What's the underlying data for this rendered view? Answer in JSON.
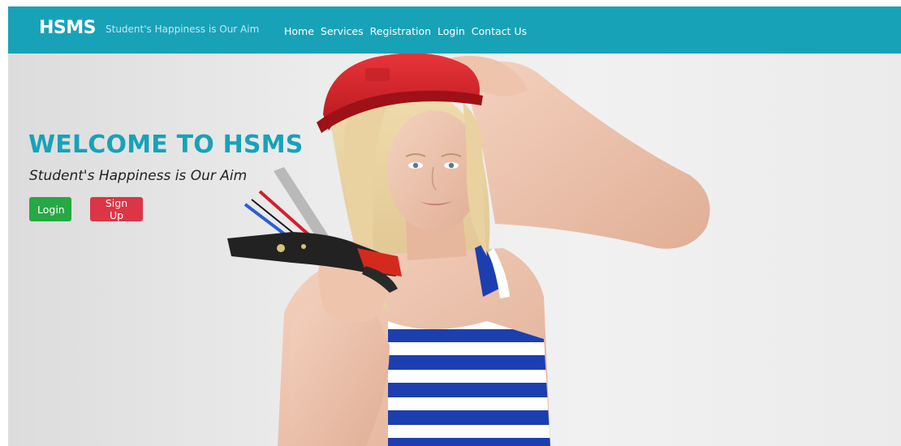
{
  "navbar": {
    "brand": "HSMS",
    "tagline": "Student's Happiness is Our Aim",
    "links": [
      "Home",
      "Services",
      "Registration",
      "Login",
      "Contact Us"
    ],
    "background_color": "#17a2b8"
  },
  "hero": {
    "title": "WELCOME TO HSMS",
    "subtitle": "Student's Happiness is Our Aim",
    "login_button": "Login",
    "signup_button": "Sign Up",
    "title_color": "#17a2b8",
    "login_color": "#28a745",
    "signup_color": "#dc3545"
  }
}
